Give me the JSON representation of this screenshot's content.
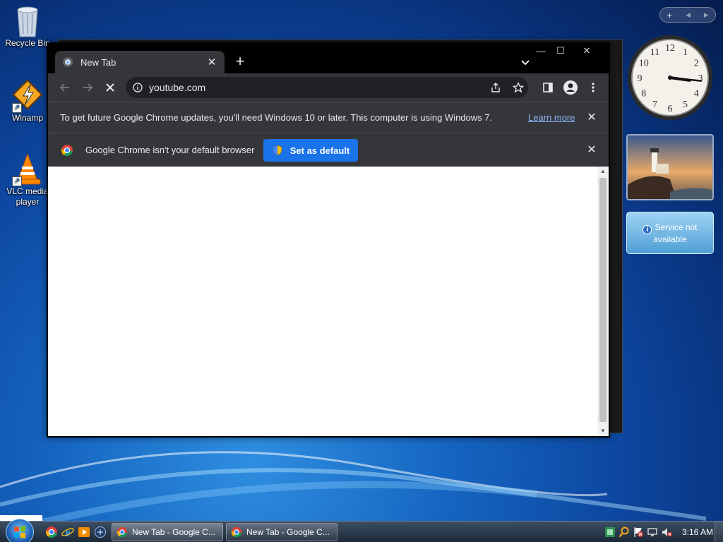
{
  "desktop": {
    "icons": [
      {
        "label": "Recycle Bin",
        "icon": "recycle-bin-icon"
      },
      {
        "label": "Winamp",
        "icon": "winamp-icon"
      },
      {
        "label": "VLC media player",
        "icon": "vlc-icon"
      }
    ]
  },
  "gadgets": {
    "controls": {
      "add": "+",
      "prev": "◂",
      "next": "▸"
    },
    "clock": {
      "hour": 3,
      "minute": 16
    },
    "weather": {
      "message": "Service not available"
    }
  },
  "chrome": {
    "tab": {
      "title": "New Tab",
      "close": "✕"
    },
    "new_tab": "+",
    "caption": {
      "minimize": "—",
      "maximize": "☐",
      "close": "✕"
    },
    "omnibox": {
      "url": "youtube.com"
    },
    "infobar_update": {
      "message": "To get future Google Chrome updates, you'll need Windows 10 or later. This computer is using Windows 7.",
      "link": "Learn more",
      "close": "✕"
    },
    "infobar_default": {
      "message": "Google Chrome isn't your default browser",
      "button": "Set as default",
      "close": "✕"
    }
  },
  "taskbar": {
    "buttons": [
      {
        "label": "New Tab - Google C..."
      },
      {
        "label": "New Tab - Google C..."
      }
    ],
    "clock": "3:16 AM"
  },
  "colors": {
    "chrome_bg": "#202124",
    "chrome_toolbar": "#35363a",
    "accent_blue": "#1a73e8",
    "link": "#8ab4f8"
  }
}
